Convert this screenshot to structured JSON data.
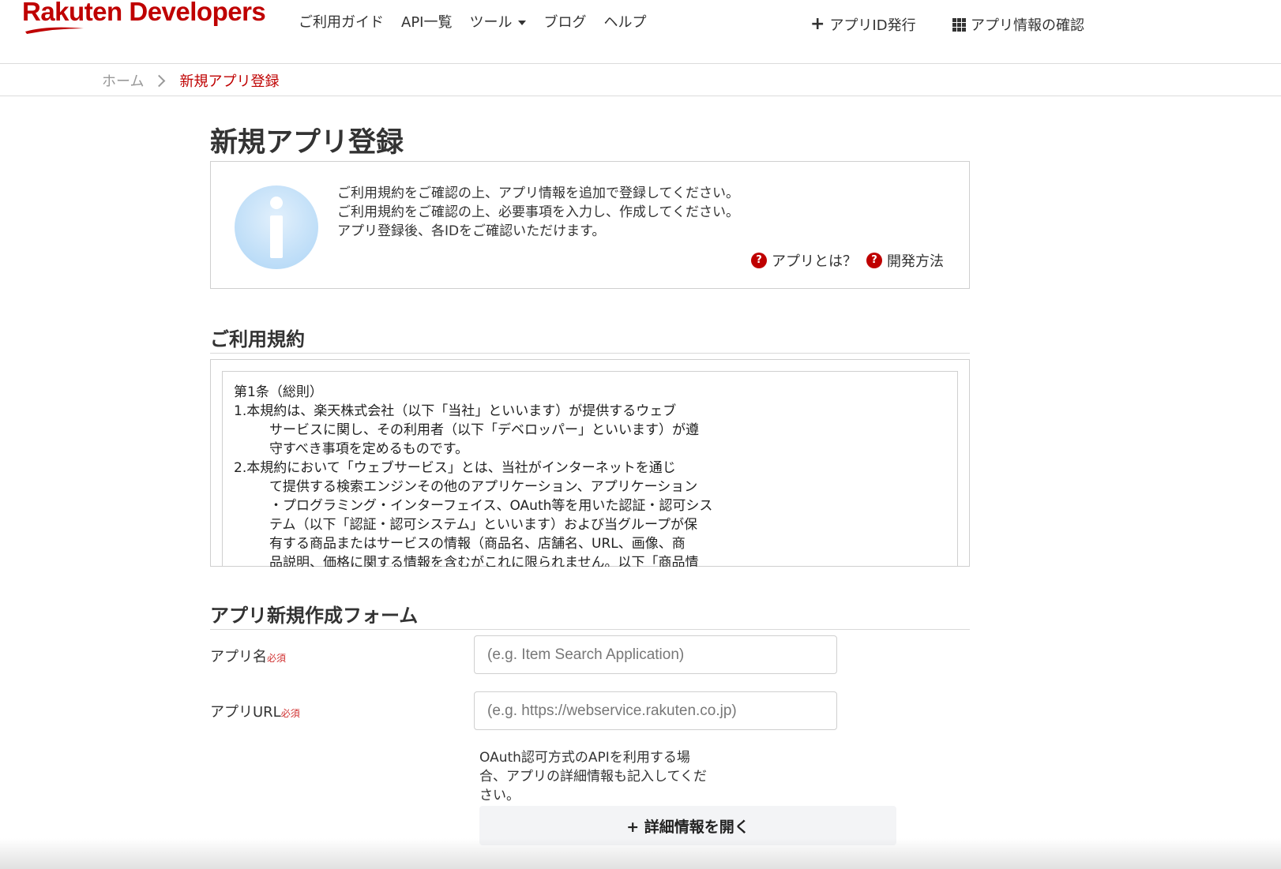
{
  "header": {
    "logo_text": "Rakuten Developers",
    "nav": {
      "guide": "ご利用ガイド",
      "api_list": "API一覧",
      "tools": "ツール",
      "blog": "ブログ",
      "help": "ヘルプ"
    },
    "issue_app_id": "アプリID発行",
    "check_app_info": "アプリ情報の確認"
  },
  "breadcrumb": {
    "home": "ホーム",
    "current": "新規アプリ登録"
  },
  "page_title": "新規アプリ登録",
  "info": {
    "line1": "ご利用規約をご確認の上、アプリ情報を追加で登録してください。",
    "line2": "ご利用規約をご確認の上、必要事項を入力し、作成してください。",
    "line3": "アプリ登録後、各IDをご確認いただけます。",
    "what_is_app": "アプリとは？",
    "dev_method": "開発方法"
  },
  "terms": {
    "title": "ご利用規約",
    "lines": [
      "第1条（総則）",
      "1.本規約は、楽天株式会社（以下「当社」といいます）が提供するウェブ",
      "サービスに関し、その利用者（以下「デベロッパー」といいます）が遵",
      "守すべき事項を定めるものです。",
      "2.本規約において「ウェブサービス」とは、当社がインターネットを通じ",
      "て提供する検索エンジンその他のアプリケーション、アプリケーション",
      "・プログラミング・インターフェイス、OAuth等を用いた認証・認可シス",
      "テム（以下「認証・認可システム」といいます）および当グループが保",
      "有する商品またはサービスの情報（商品名、店舗名、URL、画像、商",
      "品説明、価格に関する情報を含むがこれに限られません。以下「商品情"
    ]
  },
  "form": {
    "title": "アプリ新規作成フォーム",
    "required_mark": "必須",
    "app_name_label": "アプリ名",
    "app_name_placeholder": "(e.g. Item Search Application)",
    "app_url_label": "アプリURL",
    "app_url_placeholder": "(e.g. https://webservice.rakuten.co.jp)",
    "oauth_note": "OAuth認可方式のAPIを利用する場合、アプリの詳細情報も記入してください。",
    "detail_button": "+ 詳細情報を開く"
  },
  "colors": {
    "brand_red": "#bf0000",
    "required_red": "#d03030",
    "info_icon_blue": "#b9dbf7"
  }
}
